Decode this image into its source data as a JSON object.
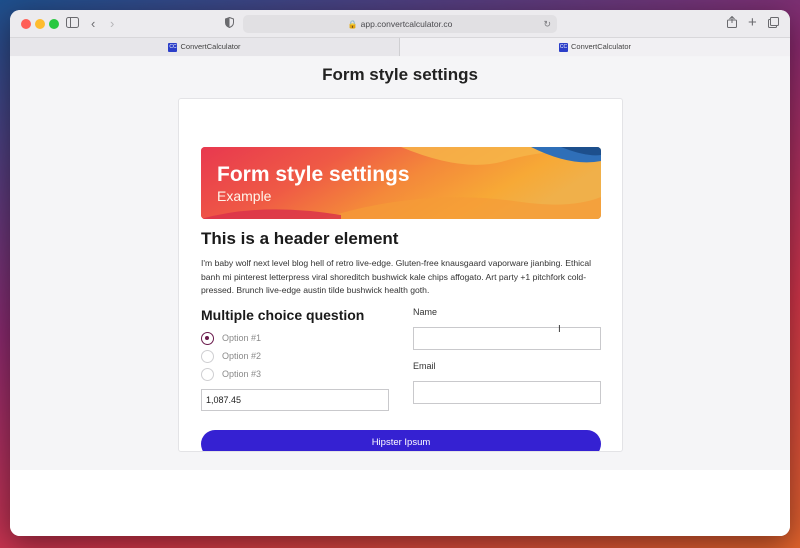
{
  "browser": {
    "url": "app.convertcalculator.co",
    "tabs": [
      {
        "label": "ConvertCalculator",
        "favicon": "CC"
      },
      {
        "label": "ConvertCalculator",
        "favicon": "CC"
      }
    ]
  },
  "page": {
    "title": "Form style settings"
  },
  "banner": {
    "title": "Form style settings",
    "subtitle": "Example"
  },
  "header_element": "This is a header element",
  "paragraph": "I'm baby wolf next level blog hell of retro live-edge. Gluten-free knausgaard vaporware jianbing. Ethical banh mi pinterest letterpress viral shoreditch bushwick kale chips affogato. Art party +1 pitchfork cold-pressed. Brunch live-edge austin tilde bushwick health goth.",
  "multiple_choice": {
    "title": "Multiple choice question",
    "options": [
      "Option #1",
      "Option #2",
      "Option #3"
    ],
    "selected": "Option #1"
  },
  "number_field": {
    "value": "1,087.45"
  },
  "name_field": {
    "label": "Name",
    "value": ""
  },
  "email_field": {
    "label": "Email",
    "value": ""
  },
  "submit_button": {
    "label": "Hipster Ipsum"
  },
  "colors": {
    "button": "#3521d2",
    "radio_selected": "#6a1a4c"
  }
}
